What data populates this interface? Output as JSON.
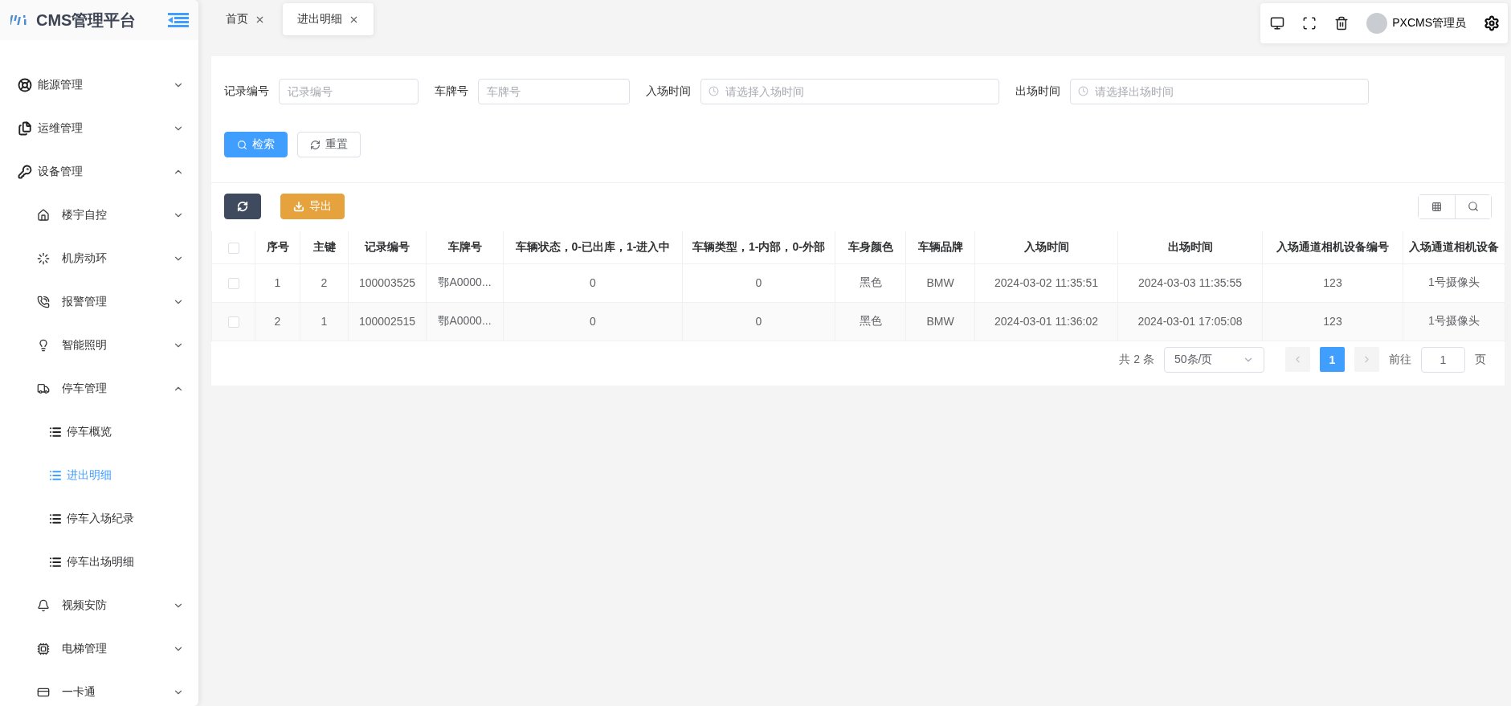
{
  "sidebar": {
    "logo": "CMS管理平台",
    "items": [
      {
        "label": "能源管理",
        "expanded": false
      },
      {
        "label": "运维管理",
        "expanded": false
      },
      {
        "label": "设备管理",
        "expanded": true,
        "children": [
          {
            "label": "楼宇自控",
            "expanded": false
          },
          {
            "label": "机房动环",
            "expanded": false
          },
          {
            "label": "报警管理",
            "expanded": false
          },
          {
            "label": "智能照明",
            "expanded": false
          },
          {
            "label": "停车管理",
            "expanded": true,
            "children": [
              {
                "label": "停车概览",
                "selected": false
              },
              {
                "label": "进出明细",
                "selected": true
              },
              {
                "label": "停车入场纪录",
                "selected": false
              },
              {
                "label": "停车出场明细",
                "selected": false
              }
            ]
          },
          {
            "label": "视频安防",
            "expanded": false
          },
          {
            "label": "电梯管理",
            "expanded": false
          },
          {
            "label": "一卡通",
            "expanded": false
          }
        ]
      }
    ]
  },
  "tabs": [
    {
      "label": "首页",
      "selected": false
    },
    {
      "label": "进出明细",
      "selected": true
    }
  ],
  "toolbar": {
    "user": "PXCMS管理员"
  },
  "search": {
    "fields": [
      {
        "label": "记录编号",
        "placeholder": "记录编号",
        "kind": "text"
      },
      {
        "label": "车牌号",
        "placeholder": "车牌号",
        "kind": "text"
      },
      {
        "label": "入场时间",
        "placeholder": "请选择入场时间",
        "kind": "time"
      },
      {
        "label": "出场时间",
        "placeholder": "请选择出场时间",
        "kind": "time"
      }
    ],
    "buttons": [
      {
        "label": "检索",
        "kind": "primary"
      },
      {
        "label": "重置",
        "kind": "default"
      }
    ]
  },
  "actions": {
    "export": "导出"
  },
  "table": {
    "all_checked": false,
    "columns": [
      "序号",
      "主键",
      "记录编号",
      "车牌号",
      "车辆状态，0-已出库，1-进入中",
      "车辆类型，1-内部，0-外部",
      "车身颜色",
      "车辆品牌",
      "入场时间",
      "出场时间",
      "入场通道相机设备编号",
      "入场通道相机设备"
    ],
    "rows": [
      {
        "checked": false,
        "cells": [
          "1",
          "2",
          "100003525",
          "鄂A0000...",
          "0",
          "0",
          "黑色",
          "BMW",
          "2024-03-02 11:35:51",
          "2024-03-03 11:35:55",
          "123",
          "1号摄像头"
        ]
      },
      {
        "checked": false,
        "cells": [
          "2",
          "1",
          "100002515",
          "鄂A0000...",
          "0",
          "0",
          "黑色",
          "BMW",
          "2024-03-01 11:36:02",
          "2024-03-01 17:05:08",
          "123",
          "1号摄像头"
        ]
      }
    ]
  },
  "pagination": {
    "total": "共 2 条",
    "page_size": "50条/页",
    "pages": [
      {
        "label": "1",
        "selected": true
      }
    ],
    "goto_label": "前往",
    "goto_value": "1",
    "goto_suffix": "页"
  }
}
